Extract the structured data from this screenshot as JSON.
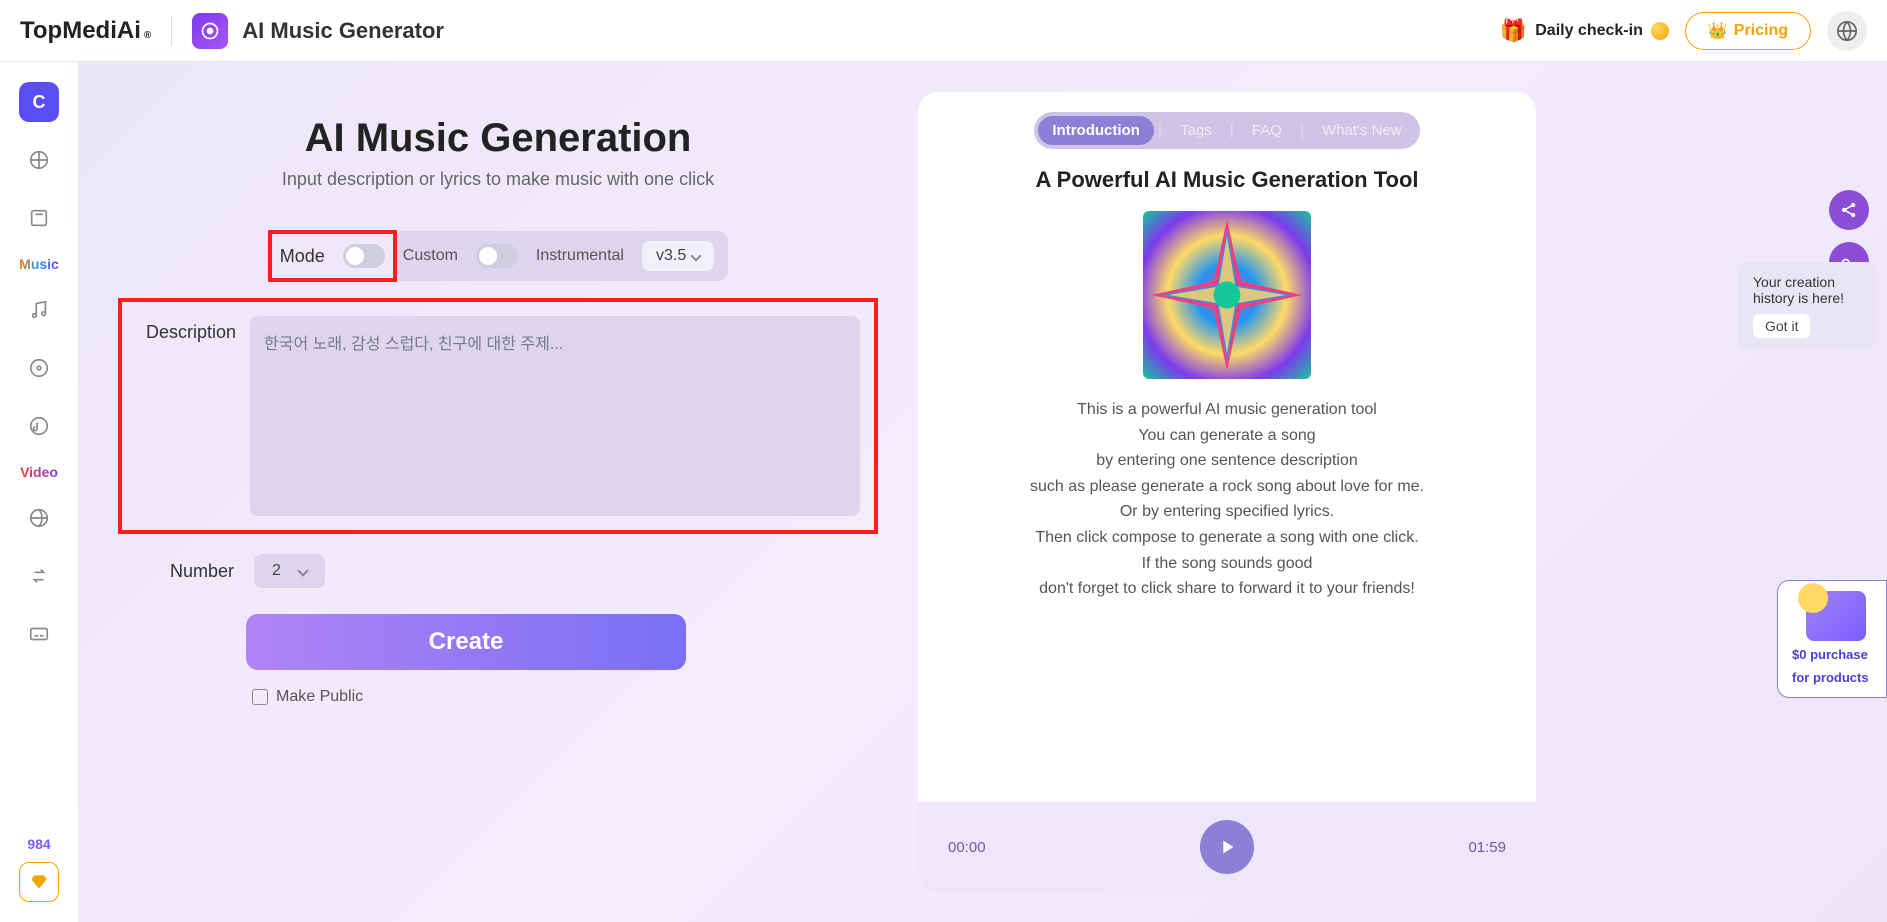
{
  "header": {
    "logo": "TopMediAi",
    "logo_sup": "®",
    "app_title": "AI Music Generator",
    "checkin": "Daily check-in",
    "pricing": "Pricing"
  },
  "sidebar": {
    "active_letter": "C",
    "music_label": "Music",
    "video_label": "Video",
    "credits": "984"
  },
  "form": {
    "title": "AI Music Generation",
    "subtitle": "Input description or lyrics to make music with one click",
    "mode_label": "Mode",
    "custom_label": "Custom",
    "instrumental_label": "Instrumental",
    "version": "v3.5",
    "desc_label": "Description",
    "desc_placeholder": "한국어 노래, 감성 스럽다, 친구에 대한 주제...",
    "number_label": "Number",
    "number_value": "2",
    "create": "Create",
    "public": "Make Public"
  },
  "panel": {
    "tabs": [
      "Introduction",
      "Tags",
      "FAQ",
      "What's New"
    ],
    "title": "A Powerful AI Music Generation Tool",
    "text_lines": [
      "This is a powerful AI music generation tool",
      "You can generate a song",
      "by entering one sentence description",
      "such as please generate a rock song about love for me.",
      "Or by entering specified lyrics.",
      "Then click compose to generate a song with one click.",
      "If the song sounds good",
      "don't forget to click share to forward it to your friends!"
    ],
    "time_start": "00:00",
    "time_end": "01:59"
  },
  "tooltip": {
    "text": "Your creation history is here!",
    "button": "Got it"
  },
  "promo": {
    "line1": "$0 purchase",
    "line2": "for products"
  }
}
